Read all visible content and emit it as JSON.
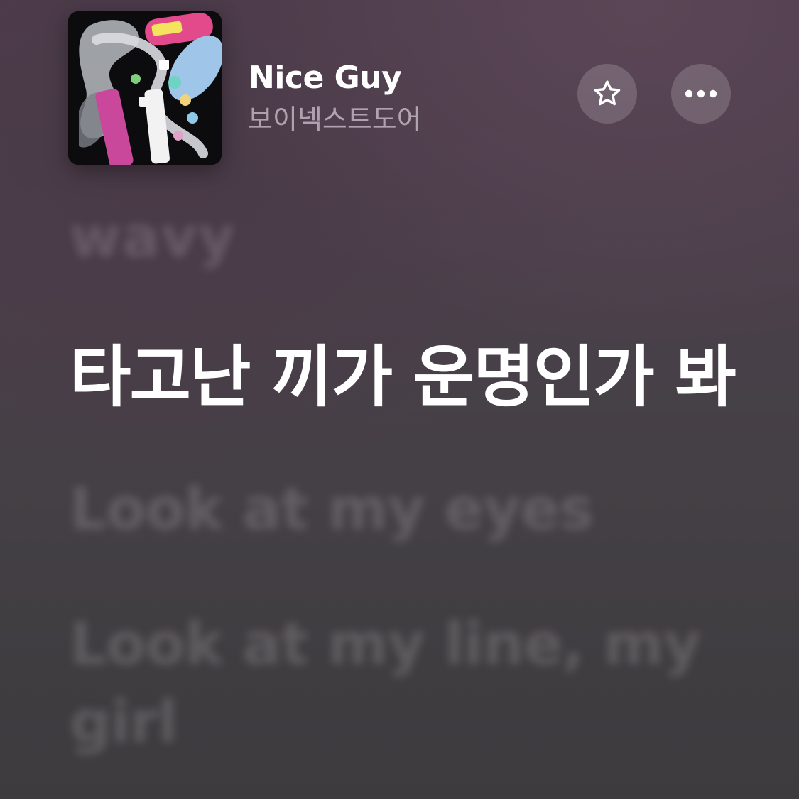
{
  "now_playing": {
    "title": "Nice Guy",
    "artist": "보이넥스트도어",
    "artwork_icon": "album-artwork"
  },
  "actions": {
    "favorite_icon": "star-icon",
    "more_icon": "ellipsis-icon"
  },
  "lyrics": {
    "previous_line": "wavy",
    "current_line": "타고난 끼가 운명인가 봐",
    "next_lines": [
      "Look at my eyes",
      "Look at my line, my girl"
    ]
  },
  "colors": {
    "background_top": "#4d3b4b",
    "background_bottom": "#3d3b3e",
    "active_lyric": "#ffffff",
    "button_fill": "rgba(255,255,255,0.17)"
  }
}
